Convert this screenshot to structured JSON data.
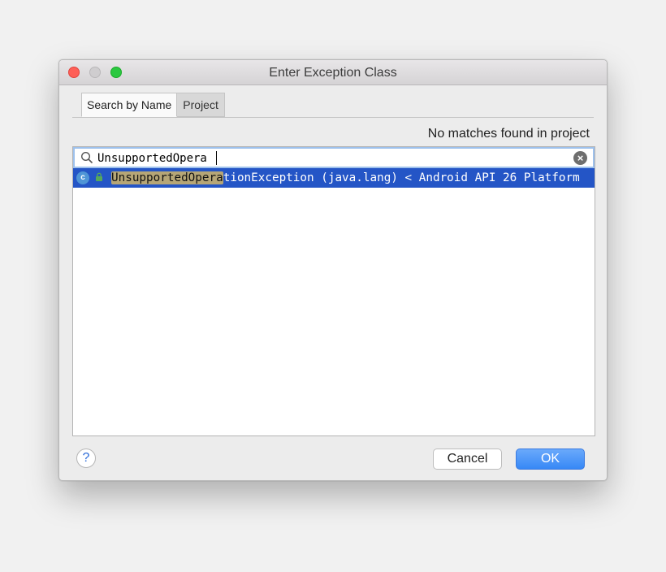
{
  "window": {
    "title": "Enter Exception Class"
  },
  "tabs": [
    {
      "label": "Search by Name",
      "active": true
    },
    {
      "label": "Project",
      "active": false
    }
  ],
  "status": "No matches found in project",
  "search": {
    "value": "UnsupportedOpera"
  },
  "result": {
    "match": "UnsupportedOpera",
    "rest": "tionException (java.lang)",
    "location": "< Android API 26 Platform"
  },
  "buttons": {
    "help": "?",
    "cancel": "Cancel",
    "ok": "OK"
  },
  "colors": {
    "selection": "#2455c6",
    "match_highlight": "#b6a676",
    "ok_button": "#3788f6"
  },
  "icons": [
    "search-icon",
    "clear-icon",
    "class-icon",
    "lock-icon",
    "help-icon"
  ]
}
